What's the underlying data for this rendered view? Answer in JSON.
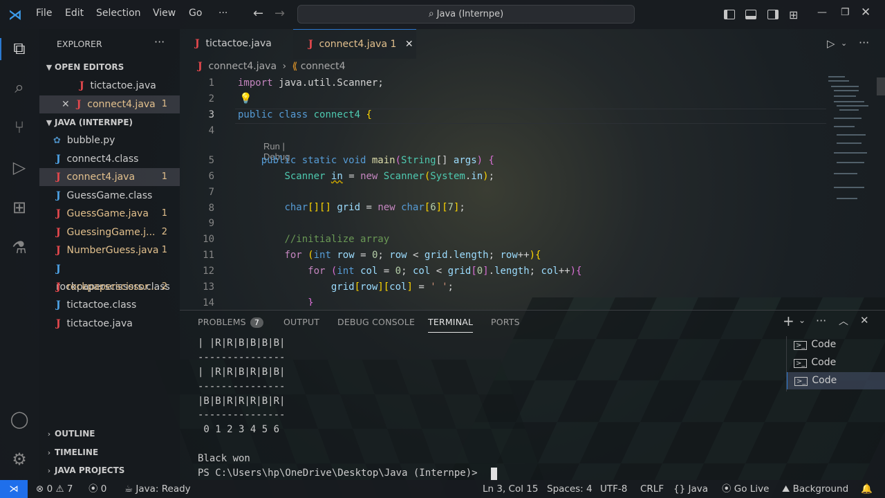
{
  "menu": [
    "File",
    "Edit",
    "Selection",
    "View",
    "Go",
    "···"
  ],
  "command_center": "Java (Internpe)",
  "explorer": {
    "title": "EXPLORER",
    "open_editors_label": "OPEN EDITORS",
    "open_editors": [
      {
        "name": "tictactoe.java",
        "badge": ""
      },
      {
        "name": "connect4.java",
        "badge": "1"
      }
    ],
    "folder_label": "JAVA (INTERNPE)",
    "files": [
      {
        "name": "bubble.py",
        "badge": ""
      },
      {
        "name": "connect4.class",
        "badge": ""
      },
      {
        "name": "connect4.java",
        "badge": "1"
      },
      {
        "name": "GuessGame.class",
        "badge": ""
      },
      {
        "name": "GuessGame.java",
        "badge": "1"
      },
      {
        "name": "GuessingGame.j...",
        "badge": "2"
      },
      {
        "name": "NumberGuess.java",
        "badge": "1"
      },
      {
        "name": "rockpaperscissors.class",
        "badge": ""
      },
      {
        "name": "rockpaperscissor...",
        "badge": "2"
      },
      {
        "name": "tictactoe.class",
        "badge": ""
      },
      {
        "name": "tictactoe.java",
        "badge": ""
      }
    ],
    "outline_label": "OUTLINE",
    "timeline_label": "TIMELINE",
    "java_projects_label": "JAVA PROJECTS"
  },
  "tabs": [
    {
      "name": "tictactoe.java",
      "badge": ""
    },
    {
      "name": "connect4.java",
      "badge": "1"
    }
  ],
  "breadcrumb": {
    "file": "connect4.java",
    "symbol": "connect4"
  },
  "codelens": "Run | Debug",
  "line_numbers": [
    "1",
    "2",
    "3",
    "4",
    "5",
    "6",
    "7",
    "8",
    "9",
    "10",
    "11",
    "12",
    "13",
    "14"
  ],
  "code": {
    "l1_import": "import",
    "l1_pkg": "java.util.Scanner",
    "l3_public": "public",
    "l3_class": "class",
    "l3_name": "connect4",
    "l5_mods": "public static void",
    "l5_main": "main",
    "l5_type": "String",
    "l5_args": "args",
    "l6_type": "Scanner",
    "l6_in": "in",
    "l6_new": "new",
    "l6_ctor": "Scanner",
    "l6_sys": "System",
    "l6_field": "in",
    "l8_type": "char",
    "l8_grid": "grid",
    "l8_new": "new",
    "l8_type2": "char",
    "l8_n6": "6",
    "l8_n7": "7",
    "l10_comment": "//initialize array",
    "l11_for": "for",
    "l11_int": "int",
    "l11_row": "row",
    "l11_zero": "0",
    "l11_row2": "row",
    "l11_grid": "grid",
    "l11_length": "length",
    "l11_row3": "row",
    "l12_for": "for",
    "l12_int": "int",
    "l12_col": "col",
    "l12_zero": "0",
    "l12_col2": "col",
    "l12_grid": "grid",
    "l12_idx": "0",
    "l12_length": "length",
    "l12_col3": "col",
    "l13_grid": "grid",
    "l13_row": "row",
    "l13_col": "col",
    "l13_char": "' '"
  },
  "panel": {
    "tabs": [
      "PROBLEMS",
      "OUTPUT",
      "DEBUG CONSOLE",
      "TERMINAL",
      "PORTS"
    ],
    "problems_count": "7",
    "active": "TERMINAL"
  },
  "terminal_lines": [
    "| |R|R|B|B|B|B|",
    "---------------",
    "| |R|R|B|R|B|B|",
    "---------------",
    "|B|B|R|R|R|B|R|",
    "---------------",
    " 0 1 2 3 4 5 6",
    "",
    "Black won",
    "PS C:\\Users\\hp\\OneDrive\\Desktop\\Java (Internpe)> "
  ],
  "terminal_list": [
    "Code",
    "Code",
    "Code"
  ],
  "status": {
    "errors": "0",
    "warnings": "7",
    "ports": "0",
    "java": "Java: Ready",
    "position": "Ln 3, Col 15",
    "spaces": "Spaces: 4",
    "encoding": "UTF-8",
    "eol": "CRLF",
    "language": "Java",
    "golive": "Go Live",
    "background": "Background"
  },
  "colors": {
    "accent": "#2b79d0",
    "modified": "#e2c08d",
    "remote": "#1f6feb"
  }
}
